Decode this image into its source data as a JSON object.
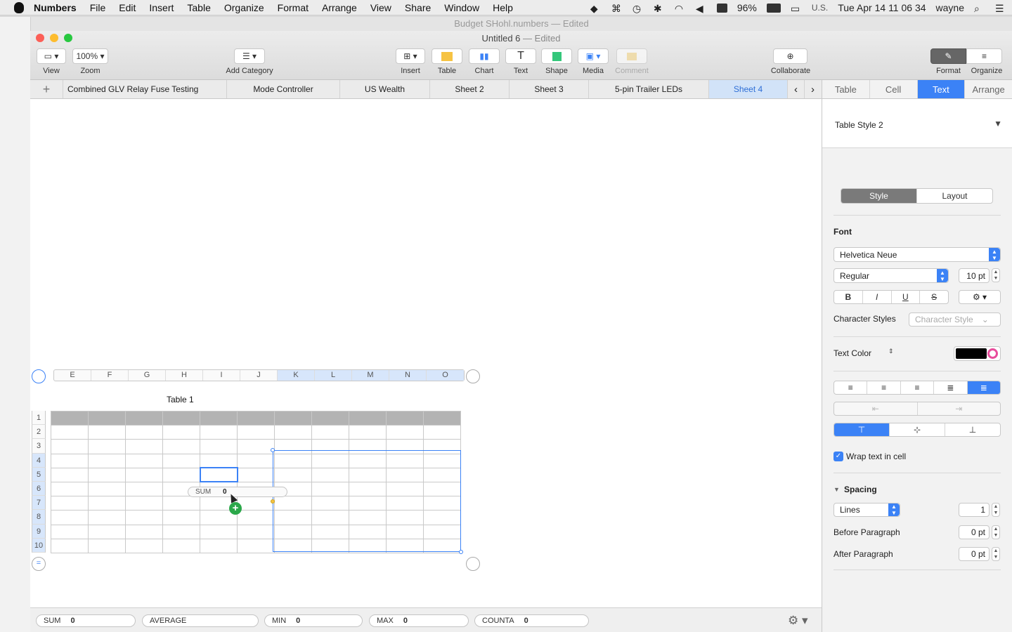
{
  "menubar": {
    "app": "Numbers",
    "items": [
      "File",
      "Edit",
      "Insert",
      "Table",
      "Organize",
      "Format",
      "Arrange",
      "View",
      "Share",
      "Window",
      "Help"
    ],
    "battery": "96%",
    "input_source": "U.S.",
    "clock": "Tue Apr 14  11 06 34",
    "user": "wayne"
  },
  "background_window": {
    "title": "Budget SHohl.numbers",
    "status": "— Edited"
  },
  "window": {
    "title": "Untitled 6",
    "status": "— Edited"
  },
  "toolbar": {
    "view_label": "View",
    "zoom_value": "100%",
    "zoom_label": "Zoom",
    "add_category_label": "Add Category",
    "insert_label": "Insert",
    "table_label": "Table",
    "chart_label": "Chart",
    "text_label": "Text",
    "shape_label": "Shape",
    "media_label": "Media",
    "comment_label": "Comment",
    "collaborate_label": "Collaborate",
    "format_label": "Format",
    "organize_label": "Organize"
  },
  "sheets": {
    "add": "+",
    "tabs": [
      "Combined GLV Relay Fuse Testing",
      "Mode Controller",
      "US Wealth",
      "Sheet 2",
      "Sheet 3",
      "5-pin Trailer LEDs",
      "Sheet 4"
    ],
    "active": "Sheet 4"
  },
  "inspector": {
    "tabs": [
      "Table",
      "Cell",
      "Text",
      "Arrange"
    ],
    "active_tab": "Text",
    "style_name": "Table Style 2",
    "style_toggle": [
      "Style",
      "Layout"
    ],
    "font_section": "Font",
    "font_family": "Helvetica Neue",
    "font_typeface": "Regular",
    "font_size": "10 pt",
    "bold": "B",
    "italic": "I",
    "underline": "U",
    "strike": "S",
    "character_styles_label": "Character Styles",
    "character_style_placeholder": "Character Style",
    "text_color_label": "Text Color",
    "text_color": "#000000",
    "wrap_label": "Wrap text in cell",
    "spacing_label": "Spacing",
    "spacing_mode": "Lines",
    "spacing_value": "1",
    "before_paragraph_label": "Before Paragraph",
    "before_paragraph_value": "0 pt",
    "after_paragraph_label": "After Paragraph",
    "after_paragraph_value": "0 pt"
  },
  "table": {
    "title": "Table 1",
    "columns": [
      "E",
      "F",
      "G",
      "H",
      "I",
      "J",
      "K",
      "L",
      "M",
      "N",
      "O"
    ],
    "selected_columns": [
      "K",
      "L",
      "M",
      "N",
      "O"
    ],
    "rows": [
      "1",
      "2",
      "3",
      "4",
      "5",
      "6",
      "7",
      "8",
      "9",
      "10"
    ],
    "selected_rows": [
      "4",
      "5",
      "6",
      "7",
      "8",
      "9",
      "10"
    ]
  },
  "tooltip": {
    "label": "SUM",
    "value": "0"
  },
  "statusbar": [
    {
      "label": "SUM",
      "value": "0"
    },
    {
      "label": "AVERAGE",
      "value": ""
    },
    {
      "label": "MIN",
      "value": "0"
    },
    {
      "label": "MAX",
      "value": "0"
    },
    {
      "label": "COUNTA",
      "value": "0"
    }
  ]
}
